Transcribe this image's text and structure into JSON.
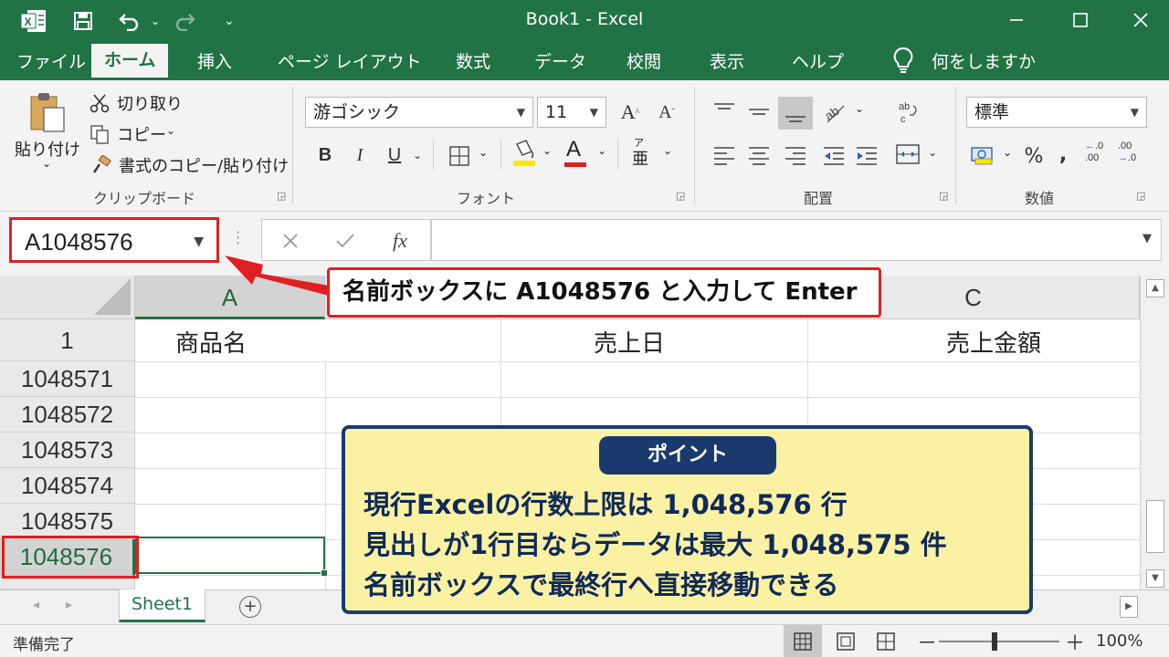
{
  "window": {
    "title": "Book1  -  Excel",
    "minimize_icon": "minimize-icon",
    "maximize_icon": "maximize-icon",
    "close_icon": "close-icon"
  },
  "menu": {
    "tabs": [
      "ファイル",
      "ホーム",
      "挿入",
      "ページ レイアウト",
      "数式",
      "データ",
      "校閲",
      "表示",
      "ヘルプ"
    ],
    "active_tab": "ホーム",
    "tell_me": "何をしますか"
  },
  "ribbon": {
    "clipboard": {
      "paste_label": "貼り付け",
      "cut_label": "切り取り",
      "copy_label": "コピー",
      "format_painter_label": "書式のコピー/貼り付け",
      "group_label": "クリップボード"
    },
    "font": {
      "font_name": "游ゴシック",
      "font_size": "11",
      "bold": "B",
      "italic": "I",
      "underline": "U",
      "font_color_glyph": "A",
      "phonetic_glyph": "亜",
      "group_label": "フォント"
    },
    "alignment": {
      "group_label": "配置"
    },
    "number": {
      "format": "標準",
      "percent": "%",
      "comma": ",",
      "inc_decimal": "←.0\n.00",
      "dec_decimal": ".00\n→.0",
      "group_label": "数値"
    },
    "colors": {
      "fill_color": "#ffe600",
      "font_color": "#e02020"
    }
  },
  "formula_bar": {
    "name_box_value": "A1048576",
    "formula_value": "",
    "fx_label": "fx"
  },
  "sheet": {
    "columns": [
      "A",
      "",
      "C"
    ],
    "header_row_number": "1",
    "headers": [
      "商品名",
      "売上日",
      "売上金額"
    ],
    "row_numbers": [
      "1048571",
      "1048572",
      "1048573",
      "1048574",
      "1048575",
      "1048576"
    ],
    "active_cell": "A1048576"
  },
  "sheet_tabs": {
    "active": "Sheet1",
    "add_label": "+"
  },
  "status": {
    "ready": "準備完了",
    "zoom": "100%",
    "zoom_minus": "－",
    "zoom_plus": "＋"
  },
  "annotations": {
    "instruction": "名前ボックスに A1048576 と入力して Enter",
    "point_title": "ポイント",
    "point_lines": [
      "現行Excelの行数上限は 1,048,576 行",
      "見出しが1行目ならデータは最大 1,048,575 件",
      "名前ボックスで最終行へ直接移動できる"
    ],
    "accent_red": "#e02020",
    "accent_navy": "#1a3a6e",
    "accent_yellow": "#fbf1a2"
  },
  "brand_color": "#217346"
}
